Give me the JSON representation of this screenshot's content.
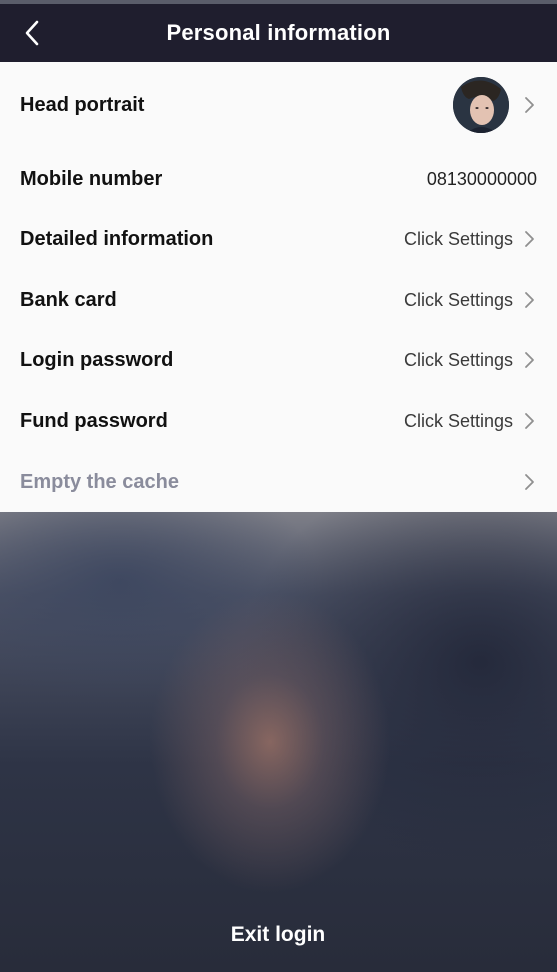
{
  "header": {
    "title": "Personal information",
    "back_icon": "chevron-left-icon"
  },
  "rows": [
    {
      "label": "Head portrait",
      "value": "",
      "icon": "chevron-right-icon"
    },
    {
      "label": "Mobile number",
      "value": "08130000000"
    },
    {
      "label": "Detailed information",
      "value": "Click Settings",
      "icon": "chevron-right-icon"
    },
    {
      "label": "Bank card",
      "value": "Click Settings",
      "icon": "chevron-right-icon"
    },
    {
      "label": "Login password",
      "value": "Click Settings",
      "icon": "chevron-right-icon"
    },
    {
      "label": "Fund password",
      "value": "Click Settings",
      "icon": "chevron-right-icon"
    },
    {
      "label": "Empty the cache",
      "value": "",
      "icon": "chevron-right-icon"
    }
  ],
  "footer": {
    "exit_label": "Exit login"
  },
  "colors": {
    "header_bg": "#1f1e2e",
    "list_bg": "#fafafa",
    "muted_label": "#8a8c9c"
  }
}
